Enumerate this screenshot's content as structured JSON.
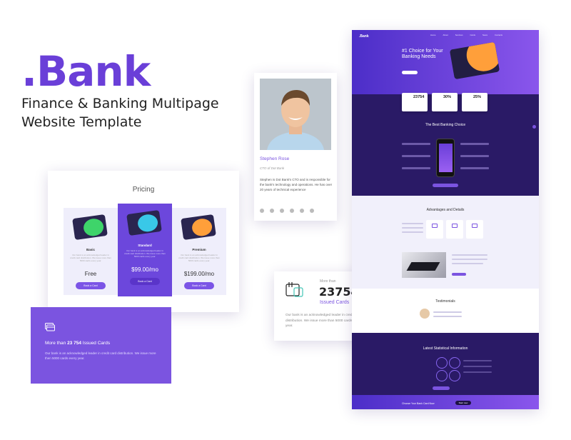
{
  "hero": {
    "brand": ".Bank",
    "subtitle": "Finance & Banking Multipage Website Template"
  },
  "pricing": {
    "title": "Pricing",
    "plans": [
      {
        "name": "Basic",
        "desc": "Our bank is an acknowledged leader in credit card distribution. We issue more than 5000 cards every year.",
        "price": "Free",
        "button": "Book a Card"
      },
      {
        "name": "Standard",
        "desc": "Our bank is an acknowledged leader in credit card distribution. We issue more than 5000 cards every year.",
        "price": "$99.00/mo",
        "button": "Book a Card"
      },
      {
        "name": "Premium",
        "desc": "Our bank is an acknowledged leader in credit card distribution. We issue more than 5000 cards every year.",
        "price": "$199.00/mo",
        "button": "Book a Card"
      }
    ]
  },
  "issued_banner": {
    "prefix": "More than ",
    "number": "23 754",
    "suffix": " Issued Cards",
    "desc": "Our bank is an acknowledged leader in credit card distribution. We issue more then 5000 cards every year."
  },
  "profile": {
    "name": "Stephen Rose",
    "role": "CTO of Dot Bank",
    "bio": "Stephen is Dot Bank's CTO and is responsible for the bank's technology and operations. He has over 20 years of technical experience"
  },
  "stat_card": {
    "more_than": "More than",
    "number": "23754",
    "label": "Issued Cards",
    "desc": "Our bank is an acknowledged leader in credit card distribution. We issue more than 5000 cards every year."
  },
  "site": {
    "logo": ".Bank",
    "nav": [
      "Home",
      "About",
      "Services",
      "Cards",
      "News",
      "Contacts"
    ],
    "headline": "#1 Choice for Your Banking Needs",
    "stats": [
      "23754",
      "30%",
      "25%"
    ],
    "best_title": "The Best Banking Choice",
    "advantages_title": "Advantages and Details",
    "testimonials_title": "Testimonials",
    "statistical_title": "Latest Statistical Information",
    "footer_text": "Choose Your Bank Card Now",
    "footer_button": "Start now"
  },
  "colors": {
    "accent": "#7b54e0",
    "dark": "#2a1a66",
    "orange": "#ff9f3a"
  }
}
